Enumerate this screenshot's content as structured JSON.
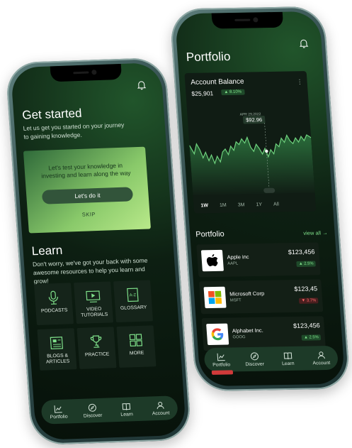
{
  "left_phone": {
    "header": {
      "title": "Get started",
      "subtitle": "Let us get you started on your journey to gaining knowledge."
    },
    "quiz_card": {
      "text": "Let's test your knowledge in investing and learn along the way",
      "button": "Let's do it",
      "skip": "SKIP"
    },
    "learn": {
      "title": "Learn",
      "subtitle": "Don't worry, we've got your back with some awesome resources to help you learn and grow!",
      "tiles": [
        {
          "label": "PODCASTS",
          "icon": "microphone-icon"
        },
        {
          "label": "VIDEO TUTORIALS",
          "icon": "video-icon"
        },
        {
          "label": "GLOSSARY",
          "icon": "book-az-icon"
        },
        {
          "label": "BLOGS & ARTICLES",
          "icon": "article-icon"
        },
        {
          "label": "PRACTICE",
          "icon": "trophy-icon"
        },
        {
          "label": "MORE",
          "icon": "grid-icon"
        }
      ]
    },
    "nav": [
      {
        "label": "Portfolio",
        "icon": "chart-line-icon"
      },
      {
        "label": "Discover",
        "icon": "compass-icon"
      },
      {
        "label": "Learn",
        "icon": "book-open-icon"
      },
      {
        "label": "Account",
        "icon": "user-icon"
      }
    ]
  },
  "right_phone": {
    "header": {
      "title": "Portfolio"
    },
    "balance_card": {
      "title": "Account Balance",
      "value": "$25,901",
      "change": "▲ 8.10%",
      "tooltip_date": "APR 29,2022",
      "tooltip_value": "$92.96",
      "ranges": [
        "1W",
        "1M",
        "3M",
        "1Y",
        "All"
      ],
      "active_range": "1W"
    },
    "portfolio": {
      "title": "Portfolio",
      "view_all": "view all →",
      "stocks": [
        {
          "name": "Apple inc",
          "ticker": "AAPL",
          "price": "$123,456",
          "change": "▲ 2.5%",
          "direction": "up"
        },
        {
          "name": "Microsoft Corp",
          "ticker": "MSFT",
          "price": "$123,45",
          "change": "▼ 3.7%",
          "direction": "down"
        },
        {
          "name": "Alphabet Inc.",
          "ticker": "GOOG",
          "price": "$123,456",
          "change": "▲ 2.5%",
          "direction": "up"
        }
      ]
    },
    "nav": [
      {
        "label": "Portfolio",
        "icon": "chart-line-icon"
      },
      {
        "label": "Discover",
        "icon": "compass-icon"
      },
      {
        "label": "Learn",
        "icon": "book-open-icon"
      },
      {
        "label": "Account",
        "icon": "user-icon"
      }
    ],
    "active_nav": "Portfolio"
  },
  "colors": {
    "accent": "#7fe08a",
    "background": "#0d1f12",
    "negative": "#ff6a6a"
  }
}
